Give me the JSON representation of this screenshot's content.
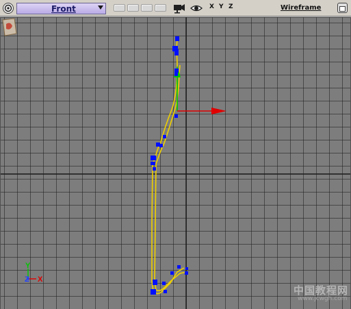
{
  "viewport": {
    "view_name": "Front",
    "shading_mode": "Wireframe",
    "axis_labels": [
      "X",
      "Y",
      "Z"
    ]
  },
  "toolbar": {
    "icons": [
      "viewport-menu-icon",
      "dropdown-arrow-icon",
      "camera-icon",
      "eye-icon",
      "maximize-icon"
    ]
  },
  "axis_tripod": {
    "y_label": "Y",
    "z_label": "Z",
    "x_label": "X"
  },
  "colors": {
    "grid_background": "#7d7d7d",
    "spline": "#f0d000",
    "control_point": "#0010ff",
    "gizmo_x": "#e00000",
    "gizmo_y": "#00c800",
    "header_bar": "#d4d0c8",
    "view_select": "#c8bdf0"
  },
  "watermark": {
    "title": "中国教程网",
    "url": "www.jcwgh.com"
  }
}
